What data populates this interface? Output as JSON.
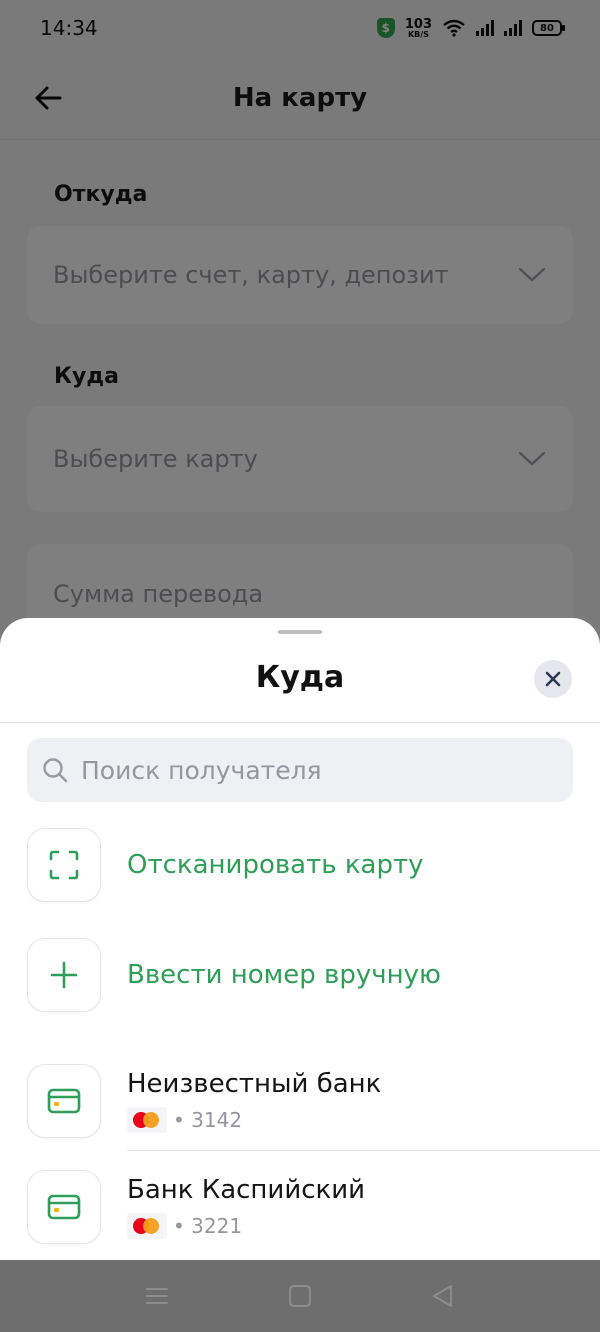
{
  "status_bar": {
    "time": "14:34",
    "net_speed": "103",
    "net_unit": "KB/S",
    "battery": "80",
    "shield_glyph": "$"
  },
  "app_bar": {
    "title": "На  карту",
    "back_icon": "arrow-left-icon"
  },
  "form": {
    "from_label": "Откуда",
    "from_placeholder": "Выберите  счет,  карту,  депозит",
    "to_label": "Куда",
    "to_placeholder": "Выберите  карту",
    "amount_placeholder": "Сумма  перевода"
  },
  "sheet": {
    "title": "Куда",
    "search_placeholder": "Поиск  получателя",
    "actions": [
      {
        "label": "Отсканировать  карту",
        "icon": "scan-frame-icon"
      },
      {
        "label": "Ввести  номер  вручную",
        "icon": "plus-icon"
      }
    ],
    "cards": [
      {
        "bank": "Неизвестный  банк",
        "masked": "• 3142",
        "icon": "credit-card-icon",
        "network": "mastercard"
      },
      {
        "bank": "Банк  Каспийский",
        "masked": "• 3221",
        "icon": "credit-card-icon",
        "network": "mastercard"
      }
    ]
  },
  "colors": {
    "accent_green": "#2e9e58",
    "card_icon_green": "#2e9e58",
    "card_chip_yellow": "#f2b51c",
    "close_bg": "#e5e7ee",
    "search_bg": "#eef0f4",
    "mastercard_red": "#eb001b",
    "mastercard_orange": "#f79e1b"
  }
}
